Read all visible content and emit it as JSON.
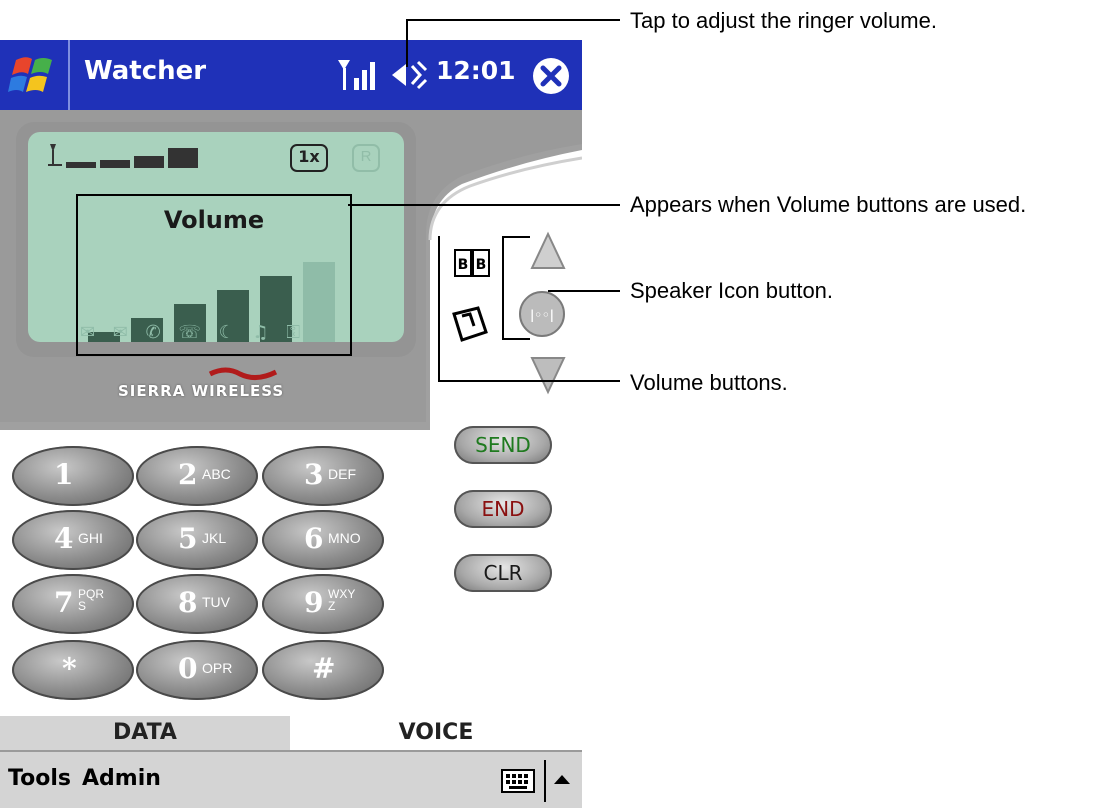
{
  "titlebar": {
    "app_title": "Watcher",
    "clock": "12:01",
    "start_icon": "windows-flag-icon",
    "signal_icon": "signal-antenna-icon",
    "volume_icon": "speaker-volume-icon",
    "close_icon": "close-x-icon",
    "color": "#1f31b8"
  },
  "lcd": {
    "title": "Volume",
    "volume_level": 5,
    "volume_max": 6,
    "indicator_1x": "1x",
    "indicator_r": "R",
    "color": "#a9d2bd"
  },
  "brand": "SIERRA WIRELESS",
  "keypad": {
    "keys": [
      {
        "num": "1",
        "sub": ""
      },
      {
        "num": "2",
        "sub": "ABC"
      },
      {
        "num": "3",
        "sub": "DEF"
      },
      {
        "num": "4",
        "sub": "GHI"
      },
      {
        "num": "5",
        "sub": "JKL"
      },
      {
        "num": "6",
        "sub": "MNO"
      },
      {
        "num": "7",
        "sub": "PQRS"
      },
      {
        "num": "8",
        "sub": "TUV"
      },
      {
        "num": "9",
        "sub": "WXYZ"
      },
      {
        "num": "*",
        "sub": ""
      },
      {
        "num": "0",
        "sub": "OPR"
      },
      {
        "num": "#",
        "sub": ""
      }
    ]
  },
  "side_buttons": {
    "send": "SEND",
    "end": "END",
    "clr": "CLR",
    "send_color": "#1f7a1f",
    "end_color": "#8a1010"
  },
  "tabs": {
    "data": "DATA",
    "voice": "VOICE"
  },
  "menubar": {
    "tools": "Tools",
    "admin": "Admin",
    "keyboard_icon": "keyboard-icon"
  },
  "callouts": {
    "ringer": "Tap to adjust the ringer volume.",
    "appears": "Appears when Volume buttons are used.",
    "speaker": "Speaker Icon button.",
    "volume_buttons": "Volume buttons."
  }
}
